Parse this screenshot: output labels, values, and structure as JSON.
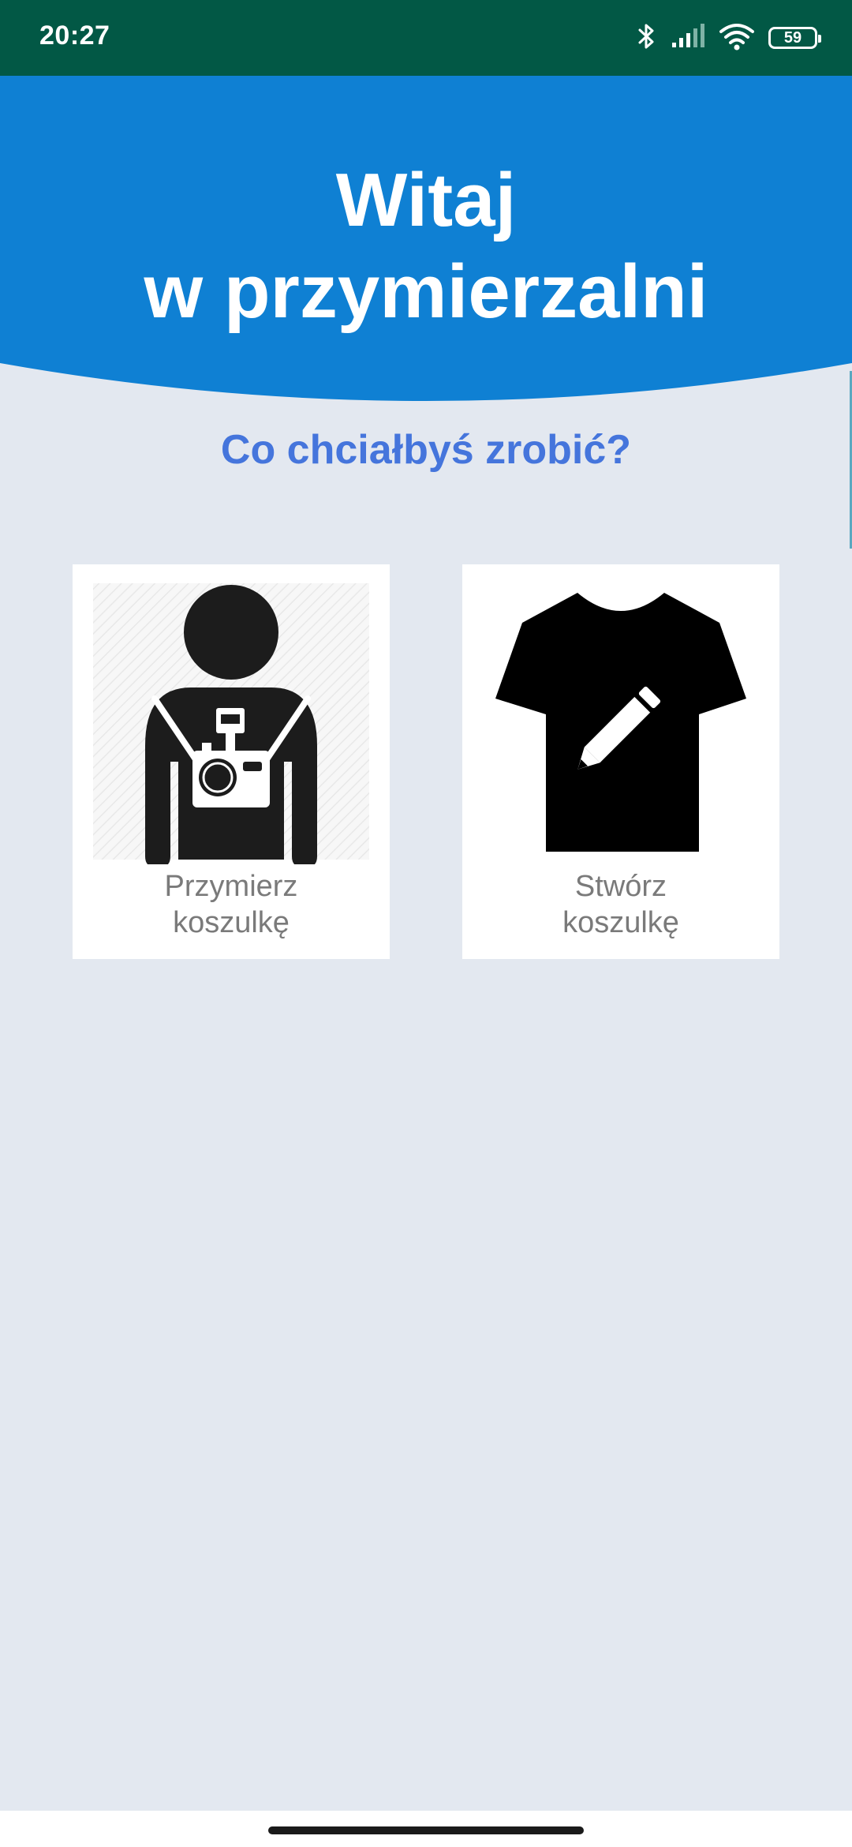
{
  "status_bar": {
    "time": "20:27",
    "battery_level": "59",
    "icons": [
      "bluetooth-icon",
      "signal-icon",
      "wifi-icon",
      "battery-icon"
    ]
  },
  "header": {
    "title_line1": "Witaj",
    "title_line2": "w przymierzalni",
    "background_color": "#0f80d3"
  },
  "prompt": "Co chciałbyś zrobić?",
  "options": [
    {
      "label_line1": "Przymierz",
      "label_line2": "koszulkę",
      "icon": "person-with-camera-icon"
    },
    {
      "label_line1": "Stwórz",
      "label_line2": "koszulkę",
      "icon": "tshirt-pencil-icon"
    }
  ],
  "colors": {
    "status_bar": "#025845",
    "accent_text": "#4575dc",
    "background": "#e3e8f0",
    "card": "#ffffff",
    "label": "#7a7a7a"
  }
}
